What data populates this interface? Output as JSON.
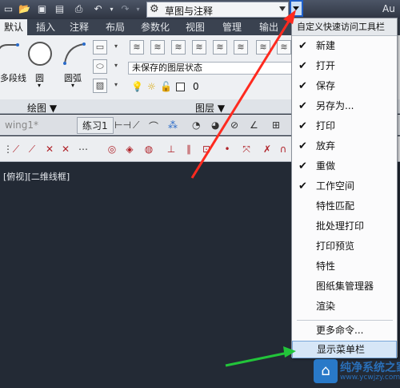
{
  "titlebar": {
    "icons": [
      "open-icon",
      "save-icon",
      "save-as-icon",
      "print-icon",
      "undo-icon",
      "redo-icon"
    ],
    "workspace": "草图与注释",
    "app_name": "Au"
  },
  "ribbon_tabs": [
    "默认",
    "插入",
    "注释",
    "布局",
    "参数化",
    "视图",
    "管理",
    "输出"
  ],
  "ribbon": {
    "draw_tools": [
      "多段线",
      "圆",
      "圆弧"
    ],
    "draw_panel_title": "绘图 ▼",
    "layer_state": "未保存的图层状态",
    "layer_current": "0",
    "layer_panel_title": "图层 ▼"
  },
  "doc_tabs": [
    "wing1*",
    "练习1"
  ],
  "viewport_label": "[俯视][二维线框]",
  "menu": {
    "title": "自定义快速访问工具栏",
    "items": [
      {
        "label": "新建",
        "checked": "✔"
      },
      {
        "label": "打开",
        "checked": "✔"
      },
      {
        "label": "保存",
        "checked": "✔"
      },
      {
        "label": "另存为...",
        "checked": "✔"
      },
      {
        "label": "打印",
        "checked": "✔"
      },
      {
        "label": "放弃",
        "checked": "✔"
      },
      {
        "label": "重做",
        "checked": "✔"
      },
      {
        "label": "工作空间",
        "checked": "✔"
      },
      {
        "label": "特性匹配",
        "checked": ""
      },
      {
        "label": "批处理打印",
        "checked": ""
      },
      {
        "label": "打印预览",
        "checked": ""
      },
      {
        "label": "特性",
        "checked": ""
      },
      {
        "label": "图纸集管理器",
        "checked": ""
      },
      {
        "label": "渲染",
        "checked": ""
      }
    ],
    "more_commands": "更多命令...",
    "show_menubar": "显示菜单栏"
  },
  "watermark": {
    "title": "纯净系统之家",
    "url": "www.ycwjzy.com"
  },
  "colors": {
    "red_arrow": "#ff2a1f",
    "green_arrow": "#22c43a"
  }
}
